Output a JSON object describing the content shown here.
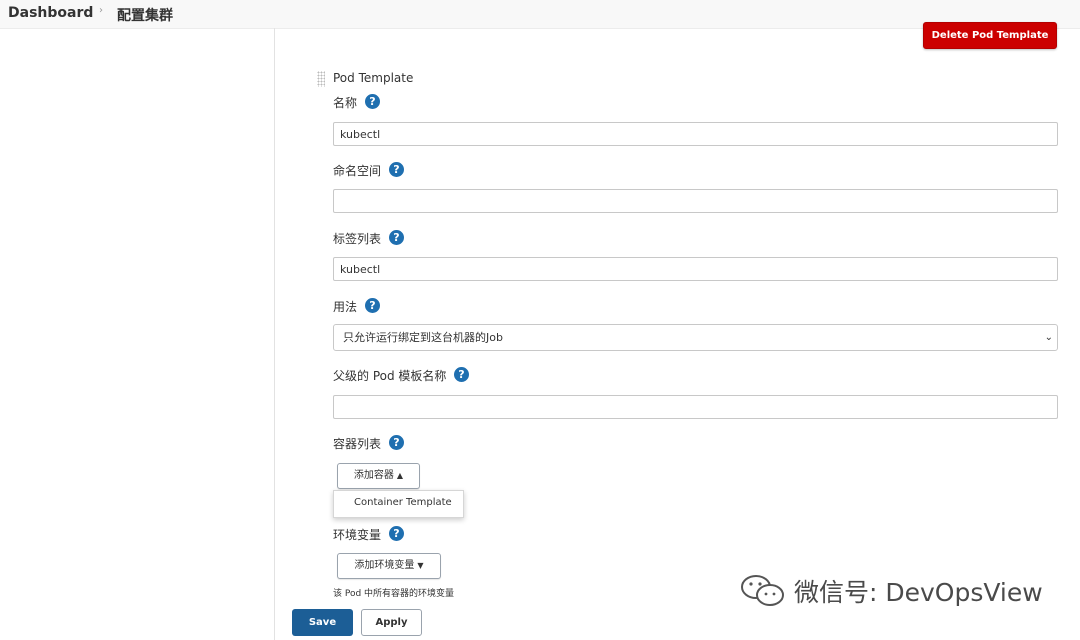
{
  "breadcrumb": {
    "home": "Dashboard",
    "separator": "›",
    "current": "配置集群"
  },
  "actions": {
    "delete_pod_template": "Delete Pod Template"
  },
  "pod_template": {
    "section_title": "Pod Template",
    "help_glyph": "?",
    "fields": {
      "name": {
        "label": "名称",
        "value": "kubectl"
      },
      "namespace": {
        "label": "命名空间",
        "value": ""
      },
      "labels": {
        "label": "标签列表",
        "value": "kubectl"
      },
      "usage": {
        "label": "用法",
        "value": "只允许运行绑定到这台机器的Job"
      },
      "parent": {
        "label": "父级的 Pod 模板名称",
        "value": ""
      },
      "containers": {
        "label": "容器列表",
        "add_button": "添加容器",
        "add_caret": "▲",
        "menu_item": "Container Template"
      },
      "env_vars": {
        "label": "环境变量",
        "add_button": "添加环境变量",
        "add_caret": "▼",
        "description": "该 Pod 中所有容器的环境变量"
      }
    }
  },
  "footer": {
    "save": "Save",
    "apply": "Apply"
  },
  "watermark": {
    "text": "微信号: DevOpsView"
  },
  "colors": {
    "danger": "#cc0000",
    "primary": "#1c5e96",
    "help": "#1f6fb0"
  }
}
